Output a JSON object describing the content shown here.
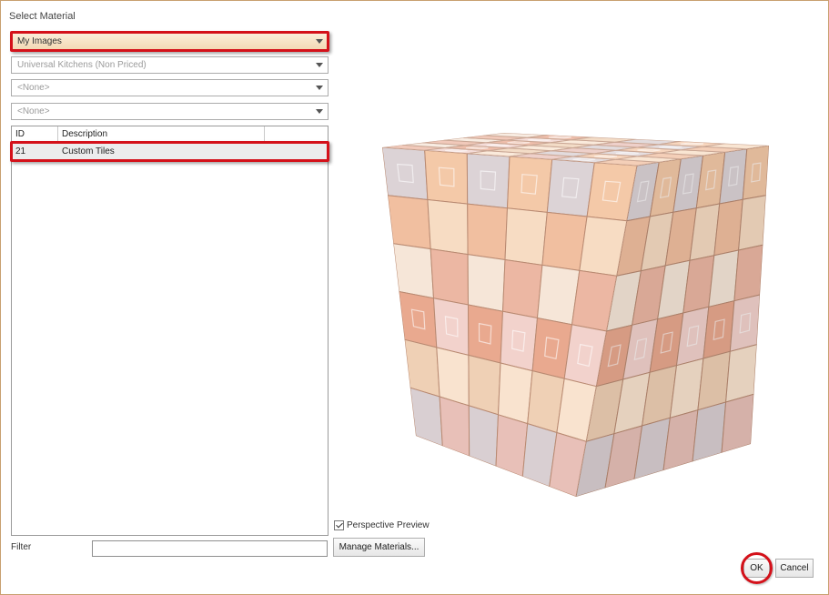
{
  "dialog": {
    "title": "Select Material"
  },
  "dropdowns": [
    {
      "value": "My Images"
    },
    {
      "value": "Universal Kitchens (Non Priced)"
    },
    {
      "value": "<None>"
    },
    {
      "value": "<None>"
    }
  ],
  "grid": {
    "columns": [
      "ID",
      "Description"
    ],
    "rows": [
      {
        "id": "21",
        "description": "Custom Tiles"
      }
    ]
  },
  "filter": {
    "label": "Filter",
    "value": ""
  },
  "preview": {
    "perspective_label": "Perspective Preview",
    "perspective_checked": true
  },
  "buttons": {
    "manage": "Manage Materials...",
    "ok": "OK",
    "cancel": "Cancel"
  },
  "colors": {
    "highlight": "#d4111a"
  }
}
